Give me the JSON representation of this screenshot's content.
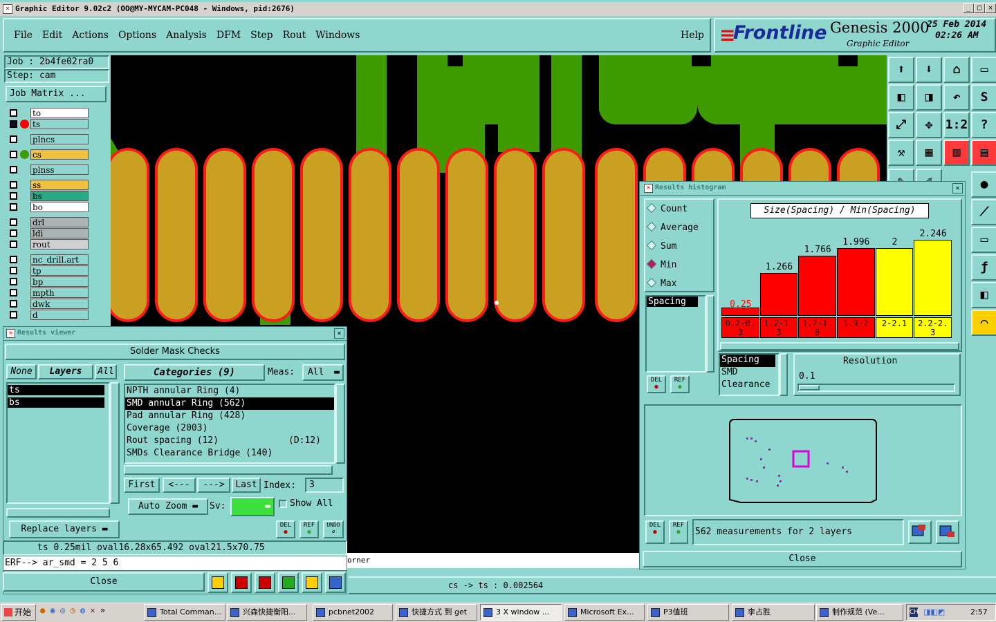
{
  "window": {
    "title": "Graphic Editor 9.02c2  (OO@MY-MYCAM-PC048 - Windows, pid:2676)"
  },
  "menu": {
    "items": [
      "File",
      "Edit",
      "Actions",
      "Options",
      "Analysis",
      "DFM",
      "Step",
      "Rout",
      "Windows"
    ],
    "help": "Help"
  },
  "brand": {
    "logo": "Frontline",
    "product": "Genesis 2000",
    "sub": "Graphic Editor",
    "date": "25 Feb 2014",
    "time": "02:26 AM"
  },
  "job": {
    "job": "Job : 2b4fe02ra0",
    "step": "Step: cam",
    "matrix": "Job Matrix ..."
  },
  "layers": [
    {
      "name": "to",
      "bg": "#ffffff"
    },
    {
      "name": "ts",
      "bg": "#8fd6cf",
      "dot": "#ff0000"
    },
    {
      "name": "plncs",
      "bg": "#8fd6cf"
    },
    {
      "name": "cs",
      "bg": "#f0c040",
      "dot": "#3e9b00"
    },
    {
      "name": "plnss",
      "bg": "#8fd6cf"
    },
    {
      "name": "ss",
      "bg": "#f0c040"
    },
    {
      "name": "bs",
      "bg": "#2ba88a"
    },
    {
      "name": "bo",
      "bg": "#ffffff"
    },
    {
      "name": "drl",
      "bg": "#a8b4b4"
    },
    {
      "name": "ldi",
      "bg": "#a8b4b4"
    },
    {
      "name": "rout",
      "bg": "#d0d0d0"
    },
    {
      "name": "nc_drill.art",
      "bg": "#8fd6cf"
    },
    {
      "name": "tp",
      "bg": "#8fd6cf"
    },
    {
      "name": "bp",
      "bg": "#8fd6cf"
    },
    {
      "name": "mpth",
      "bg": "#8fd6cf"
    },
    {
      "name": "dwk",
      "bg": "#8fd6cf"
    },
    {
      "name": "d",
      "bg": "#8fd6cf"
    }
  ],
  "results_viewer": {
    "title": "Results viewer",
    "header": "Solder Mask Checks",
    "none": "None",
    "layers": "Layers",
    "all": "All",
    "categories": "Categories (9)",
    "meas": "Meas:",
    "meas_val": "All",
    "layer_list": [
      "ts",
      "bs"
    ],
    "cats": [
      "NPTH annular Ring (4)",
      "SMD annular Ring (562)",
      "Pad annular Ring (428)",
      "Coverage (2003)",
      "Rout spacing (12)",
      "SMDs Clearance Bridge (140)"
    ],
    "cat_extra": "(D:12)",
    "first": "First",
    "prev": "<---",
    "next": "--->",
    "last": "Last",
    "index_label": "Index:",
    "index_val": "3",
    "auto_zoom": "Auto Zoom",
    "sv": "Sv:",
    "show_all": "Show All",
    "replace": "Replace layers",
    "del": "DEL",
    "ref": "REF",
    "undo": "UNDO"
  },
  "status": {
    "line1": "ts 0.25mil  oval16.28x65.492  oval21.5x70.75",
    "line2": "ERF--> ar_smd = 2 5 6",
    "close": "Close",
    "corner": "orner",
    "bottom": "cs -> ts : 0.002564"
  },
  "histogram": {
    "title": "Results histogram",
    "radios": [
      "Count",
      "Average",
      "Sum",
      "Min",
      "Max"
    ],
    "selected": "Min",
    "list": [
      "Spacing"
    ],
    "chart_title": "Size(Spacing) / Min(Spacing)",
    "bottom_list": [
      "Spacing",
      "SMD",
      "Clearance"
    ],
    "resolution": "Resolution",
    "res_val": "0.1",
    "measurements": "562 measurements for 2 layers",
    "close": "Close",
    "del": "DEL",
    "ref": "REF"
  },
  "chart_data": {
    "type": "bar",
    "title": "Size(Spacing) / Min(Spacing)",
    "categories": [
      "0.2-0.3",
      "1.2-1.3",
      "1.7-1.8",
      "1.9-2",
      "2-2.1",
      "2.2-2.3"
    ],
    "values": [
      0.25,
      1.266,
      1.766,
      1.996,
      2,
      2.246
    ],
    "labels": [
      "0.25",
      "1.266",
      "1.766",
      "1.996",
      "2",
      "2.246"
    ],
    "colors": [
      "#ff0000",
      "#ff0000",
      "#ff0000",
      "#ff0000",
      "#ffff00",
      "#ffff00"
    ],
    "ylim": [
      0,
      2.4
    ]
  },
  "taskbar": {
    "start": "开始",
    "items": [
      "Total Comman...",
      "兴森快捷衡阳...",
      "pcbnet2002",
      "快捷方式 到 get",
      "3 X window ...",
      "Microsoft Ex...",
      "P3值班",
      "李占胜",
      "制作规范 (Ve..."
    ],
    "clock": "2:57"
  }
}
